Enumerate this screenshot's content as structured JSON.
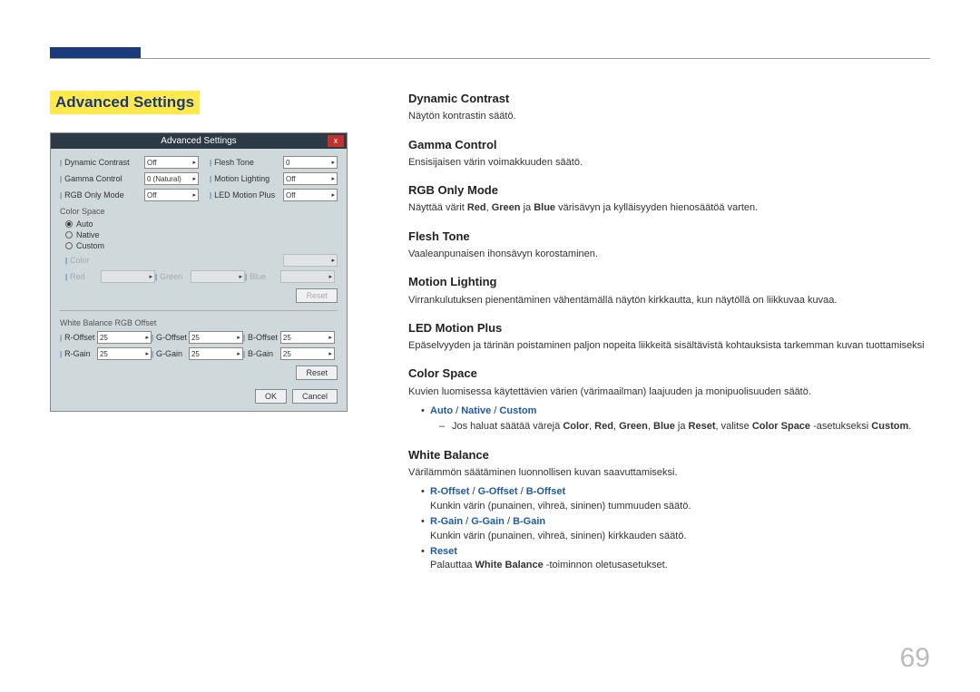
{
  "page_number": "69",
  "section_title": "Advanced Settings",
  "panel": {
    "title": "Advanced Settings",
    "close": "x",
    "rows_top": [
      {
        "l_label": "Dynamic Contrast",
        "l_val": "Off",
        "r_label": "Flesh Tone",
        "r_val": "0"
      },
      {
        "l_label": "Gamma Control",
        "l_val": "0 (Natural)",
        "r_label": "Motion Lighting",
        "r_val": "Off"
      },
      {
        "l_label": "RGB Only Mode",
        "l_val": "Off",
        "r_label": "LED Motion Plus",
        "r_val": "Off"
      }
    ],
    "color_space_label": "Color Space",
    "radios": [
      {
        "label": "Auto",
        "checked": true
      },
      {
        "label": "Native",
        "checked": false
      },
      {
        "label": "Custom",
        "checked": false
      }
    ],
    "color_row": {
      "label": "Color",
      "val": ""
    },
    "rgb_row": [
      {
        "label": "Red",
        "val": ""
      },
      {
        "label": "Green",
        "val": ""
      },
      {
        "label": "Blue",
        "val": ""
      }
    ],
    "reset1": "Reset",
    "wb_label": "White Balance RGB Offset",
    "wb_rows": [
      [
        {
          "label": "R-Offset",
          "val": "25"
        },
        {
          "label": "G-Offset",
          "val": "25"
        },
        {
          "label": "B-Offset",
          "val": "25"
        }
      ],
      [
        {
          "label": "R-Gain",
          "val": "25"
        },
        {
          "label": "G-Gain",
          "val": "25"
        },
        {
          "label": "B-Gain",
          "val": "25"
        }
      ]
    ],
    "reset2": "Reset",
    "ok": "OK",
    "cancel": "Cancel"
  },
  "content": {
    "dc": {
      "head": "Dynamic Contrast",
      "desc": "Näytön kontrastin säätö."
    },
    "gc": {
      "head": "Gamma Control",
      "desc": "Ensisijaisen värin voimakkuuden säätö."
    },
    "rgb": {
      "head": "RGB Only Mode",
      "pre": "Näyttää värit ",
      "red": "Red",
      "sep1": ", ",
      "green": "Green",
      "sep2": " ja ",
      "blue": "Blue",
      "post": " värisävyn ja kylläisyyden hienosäätöä varten."
    },
    "ft": {
      "head": "Flesh Tone",
      "desc": "Vaaleanpunaisen ihonsävyn korostaminen."
    },
    "ml": {
      "head": "Motion Lighting",
      "desc": "Virrankulutuksen pienentäminen vähentämällä näytön kirkkautta, kun näytöllä on liikkuvaa kuvaa."
    },
    "lmp": {
      "head": "LED Motion Plus",
      "desc": "Epäselvyyden ja tärinän poistaminen paljon nopeita liikkeitä sisältävistä kohtauksista tarkemman kuvan tuottamiseksi"
    },
    "cs": {
      "head": "Color Space",
      "desc": "Kuvien luomisessa käytettävien värien (värimaailman) laajuuden ja monipuolisuuden säätö.",
      "b1_auto": "Auto",
      "b1_s1": " / ",
      "b1_native": "Native",
      "b1_s2": " / ",
      "b1_custom": "Custom",
      "sub_pre": "Jos haluat säätää värejä ",
      "sub_color": "Color",
      "s1": ", ",
      "sub_red": "Red",
      "s2": ", ",
      "sub_green": "Green",
      "s3": ", ",
      "sub_blue": "Blue",
      "sub_mid": " ja ",
      "sub_reset": "Reset",
      "sub_mid2": ", valitse ",
      "sub_cs": "Color Space",
      "sub_mid3": " -asetukseksi ",
      "sub_custom": "Custom",
      "sub_end": "."
    },
    "wb": {
      "head": "White Balance",
      "desc": "Värilämmön säätäminen luonnollisen kuvan saavuttamiseksi.",
      "b1_r": "R-Offset",
      "b1_s1": " / ",
      "b1_g": "G-Offset",
      "b1_s2": " / ",
      "b1_b": "B-Offset",
      "b1_desc": "Kunkin värin (punainen, vihreä, sininen) tummuuden säätö.",
      "b2_r": "R-Gain",
      "b2_s1": " / ",
      "b2_g": "G-Gain",
      "b2_s2": " / ",
      "b2_b": "B-Gain",
      "b2_desc": "Kunkin värin (punainen, vihreä, sininen) kirkkauden säätö.",
      "b3": "Reset",
      "b3_pre": "Palauttaa ",
      "b3_wb": "White Balance",
      "b3_post": " -toiminnon oletusasetukset."
    }
  }
}
